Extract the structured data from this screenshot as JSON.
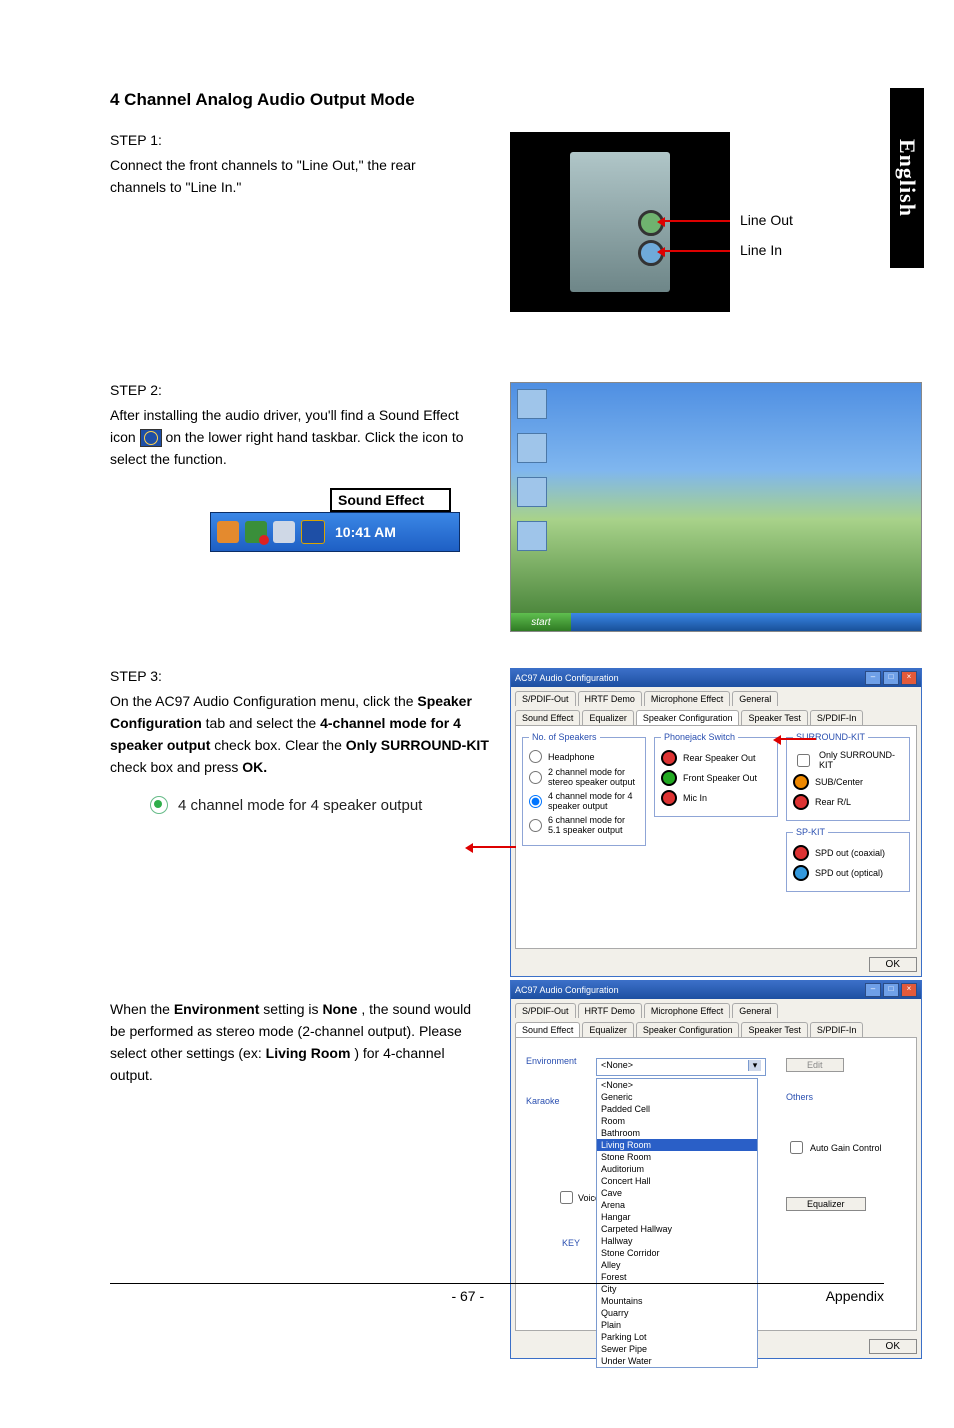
{
  "lang_tab": "English",
  "title": "4 Channel Analog Audio Output Mode",
  "step1": {
    "label": "STEP 1:",
    "text": "Connect the front channels to \"Line Out,\" the rear channels to \"Line In.\"",
    "line_out": "Line Out",
    "line_in": "Line In"
  },
  "step2": {
    "label": "STEP 2:",
    "text_a": "After installing the audio driver, you'll find a Sound Effect  icon  ",
    "text_b": " on the lower right hand taskbar. Click the icon to select the function.",
    "tooltip": "Sound Effect",
    "time": "10:41 AM",
    "start": "start"
  },
  "step3": {
    "label": "STEP 3:",
    "text_a": "On the AC97 Audio Configuration menu, click the ",
    "spk_tab": "Speaker Configuration",
    "text_b": " tab and select the ",
    "mode4": "4-channel mode for 4 speaker output",
    "text_c": " check box. Clear the ",
    "only_sur": "Only SURROUND-KIT",
    "text_d": " check box and press ",
    "ok": "OK.",
    "radio_caption": "4 channel mode for 4 speaker output"
  },
  "step4": {
    "text_a": "When the ",
    "env": "Environment",
    "text_b": " setting is ",
    "none": "None",
    "text_c": ", the sound would be performed as stereo mode (2-channel output). Please select other settings (ex: ",
    "living": "Living Room",
    "text_d": ") for 4-channel output."
  },
  "ac97": {
    "title": "AC97 Audio Configuration",
    "tabs_row1": [
      "S/PDIF-Out",
      "HRTF Demo",
      "Microphone Effect",
      "General"
    ],
    "tabs_row2": [
      "Sound Effect",
      "Equalizer",
      "Speaker Configuration",
      "Speaker Test",
      "S/PDIF-In"
    ],
    "grp_speakers": "No. of Speakers",
    "grp_phonejack": "Phonejack Switch",
    "grp_surround": "SURROUND-KIT",
    "grp_spkit": "SP-KIT",
    "opt_headphone": "Headphone",
    "opt_2ch": "2 channel mode for stereo speaker output",
    "opt_4ch": "4 channel mode for 4 speaker output",
    "opt_6ch": "6 channel mode for 5.1 speaker output",
    "jack_rear": "Rear Speaker Out",
    "jack_front": "Front Speaker Out",
    "jack_mic": "Mic In",
    "chk_only_sur": "Only SURROUND-KIT",
    "lbl_subcenter": "SUB/Center",
    "lbl_rearrl": "Rear R/L",
    "lbl_spd_coax": "SPD out (coaxial)",
    "lbl_spd_opt": "SPD out (optical)",
    "btn_ok": "OK"
  },
  "env_win": {
    "tabs_row1": [
      "S/PDIF-Out",
      "HRTF Demo",
      "Microphone Effect",
      "General"
    ],
    "tabs_row2": [
      "Sound Effect",
      "Equalizer",
      "Speaker Configuration",
      "Speaker Test",
      "S/PDIF-In"
    ],
    "grp_env": "Environment",
    "grp_karaoke": "Karaoke",
    "grp_others": "Others",
    "selected": "<None>",
    "btn_edit": "Edit",
    "chk_agc": "Auto Gain Control",
    "btn_eq": "Equalizer",
    "chk_voice": "Voice",
    "lbl_key": "KEY",
    "options": [
      "<None>",
      "Generic",
      "Padded Cell",
      "Room",
      "Bathroom",
      "Living Room",
      "Stone Room",
      "Auditorium",
      "Concert Hall",
      "Cave",
      "Arena",
      "Hangar",
      "Carpeted Hallway",
      "Hallway",
      "Stone Corridor",
      "Alley",
      "Forest",
      "City",
      "Mountains",
      "Quarry",
      "Plain",
      "Parking Lot",
      "Sewer Pipe",
      "Under Water"
    ],
    "highlight": "Living Room",
    "btn_ok": "OK"
  },
  "footer": {
    "page": "- 67 -",
    "section": "Appendix"
  }
}
